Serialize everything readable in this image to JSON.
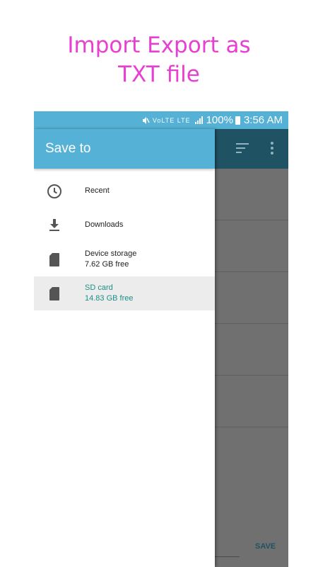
{
  "promo": {
    "line1": "Import Export as",
    "line2": "TXT file"
  },
  "status_bar": {
    "network_icons": "VoLTE LTE",
    "battery": "100%",
    "time": "3:56 AM"
  },
  "app_bar": {
    "icons": [
      "sort-icon",
      "more-vert-icon"
    ]
  },
  "drawer": {
    "title": "Save to",
    "items": [
      {
        "label": "Recent",
        "icon": "clock-icon"
      },
      {
        "label": "Downloads",
        "icon": "download-icon"
      },
      {
        "label": "Device storage",
        "sub": "7.62 GB free",
        "icon": "sd-card-icon"
      },
      {
        "label": "SD card",
        "sub": "14.83 GB free",
        "icon": "sd-card-icon",
        "selected": true
      }
    ]
  },
  "footer": {
    "save_label": "SAVE"
  },
  "colors": {
    "accent": "#55b2d6",
    "dark_toolbar": "#1f5263",
    "promo_text": "#e83fd2",
    "selected_text": "#1c8f87"
  }
}
